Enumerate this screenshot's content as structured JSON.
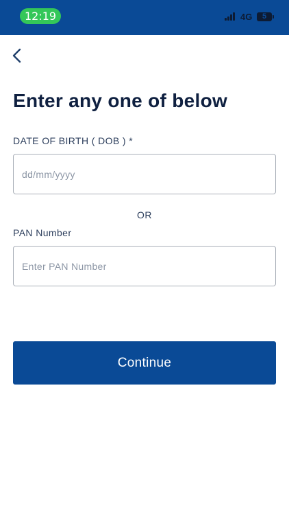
{
  "status_bar": {
    "time": "12:19",
    "network": "4G",
    "battery": "5",
    "signal_icon": "cellular-signal-icon",
    "battery_icon": "battery-icon"
  },
  "header": {
    "back_icon": "chevron-left-icon"
  },
  "main": {
    "title": "Enter any one of below",
    "dob": {
      "label": "DATE OF BIRTH ( DOB ) *",
      "value": "",
      "placeholder": "dd/mm/yyyy"
    },
    "separator": "OR",
    "pan": {
      "label": "PAN Number",
      "value": "",
      "placeholder": "Enter PAN Number"
    },
    "continue_label": "Continue"
  },
  "colors": {
    "brand": "#0a4a96",
    "title": "#0f2040",
    "time_pill": "#34c759"
  }
}
